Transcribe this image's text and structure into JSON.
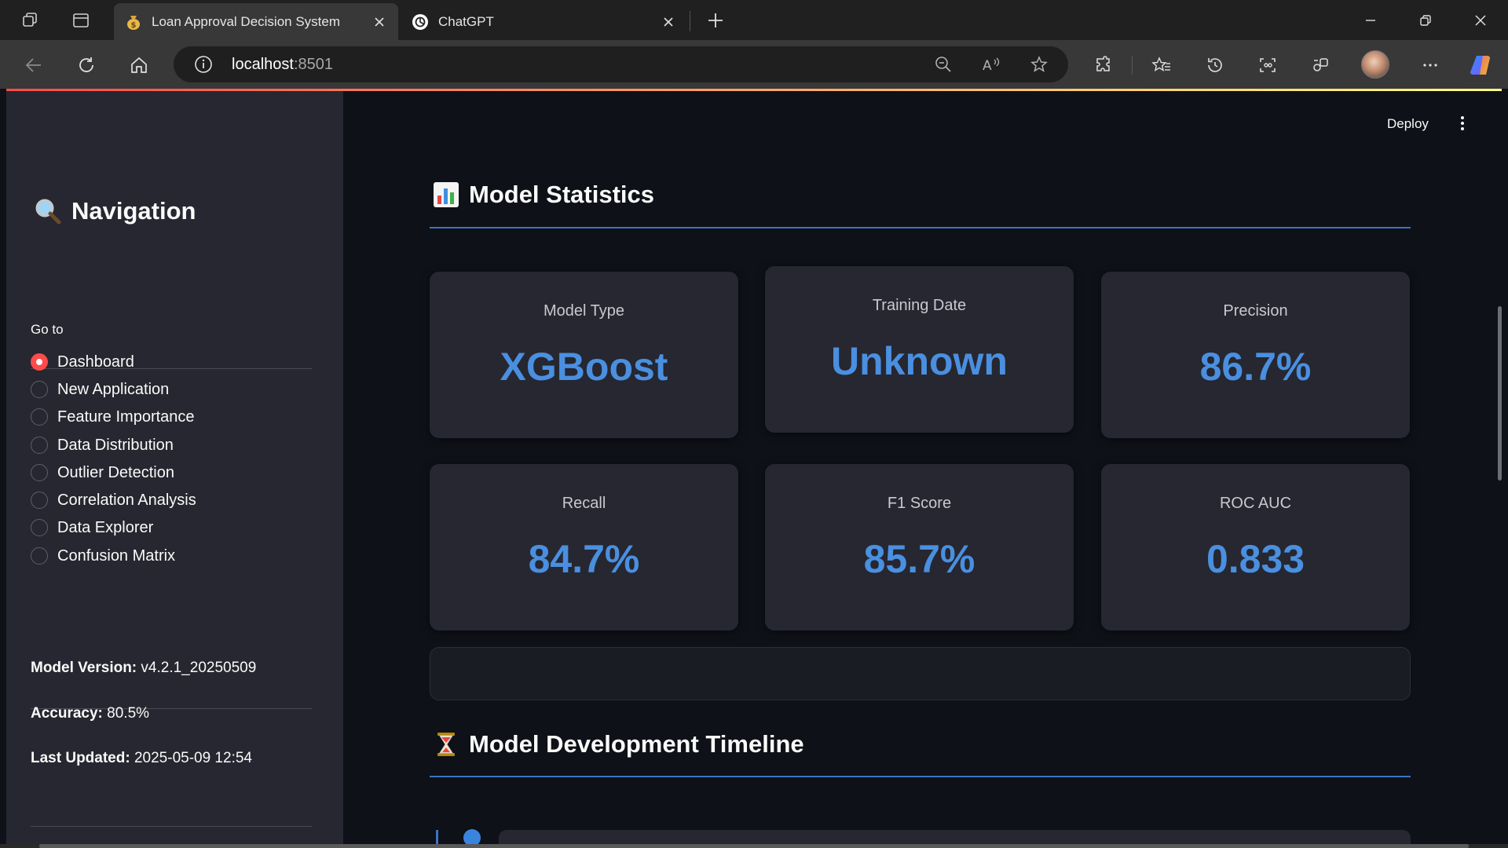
{
  "browser": {
    "tabs": [
      {
        "title": "Loan Approval Decision System",
        "icon": "money-bag-icon",
        "active": true
      },
      {
        "title": "ChatGPT",
        "icon": "chatgpt-icon",
        "active": false
      }
    ],
    "address": {
      "host": "localhost",
      "port": ":8501"
    },
    "colors": {
      "tabbar": "#202020",
      "toolbar": "#383838",
      "addressbar": "#1f1f1f"
    }
  },
  "app": {
    "header": {
      "deploy_label": "Deploy",
      "menu_icon": "kebab-menu-icon"
    },
    "sidebar": {
      "title": "Navigation",
      "title_icon": "magnifying-glass-icon",
      "radio_label": "Go to",
      "options": [
        {
          "label": "Dashboard",
          "selected": true
        },
        {
          "label": "New Application",
          "selected": false
        },
        {
          "label": "Feature Importance",
          "selected": false
        },
        {
          "label": "Data Distribution",
          "selected": false
        },
        {
          "label": "Outlier Detection",
          "selected": false
        },
        {
          "label": "Correlation Analysis",
          "selected": false
        },
        {
          "label": "Data Explorer",
          "selected": false
        },
        {
          "label": "Confusion Matrix",
          "selected": false
        }
      ],
      "info": {
        "model_version_label": "Model Version:",
        "model_version_value": "v4.2.1_20250509",
        "accuracy_label": "Accuracy:",
        "accuracy_value": "80.5%",
        "last_updated_label": "Last Updated:",
        "last_updated_value": "2025-05-09 12:54"
      }
    },
    "main": {
      "stats_title": "Model Statistics",
      "stats_icon": "bar-chart-icon",
      "metrics": [
        {
          "label": "Model Type",
          "value": "XGBoost"
        },
        {
          "label": "Training Date",
          "value": "Unknown"
        },
        {
          "label": "Precision",
          "value": "86.7%"
        },
        {
          "label": "Recall",
          "value": "84.7%"
        },
        {
          "label": "F1 Score",
          "value": "85.7%"
        },
        {
          "label": "ROC AUC",
          "value": "0.833"
        }
      ],
      "timeline_title": "Model Development Timeline",
      "timeline_icon": "hourglass-icon"
    },
    "colors": {
      "accent": "#4a8fe0",
      "radio_selected": "#ff4b4b",
      "sidebar_bg": "#262730",
      "main_bg": "#0e1117",
      "card_bg": "#262730"
    }
  }
}
